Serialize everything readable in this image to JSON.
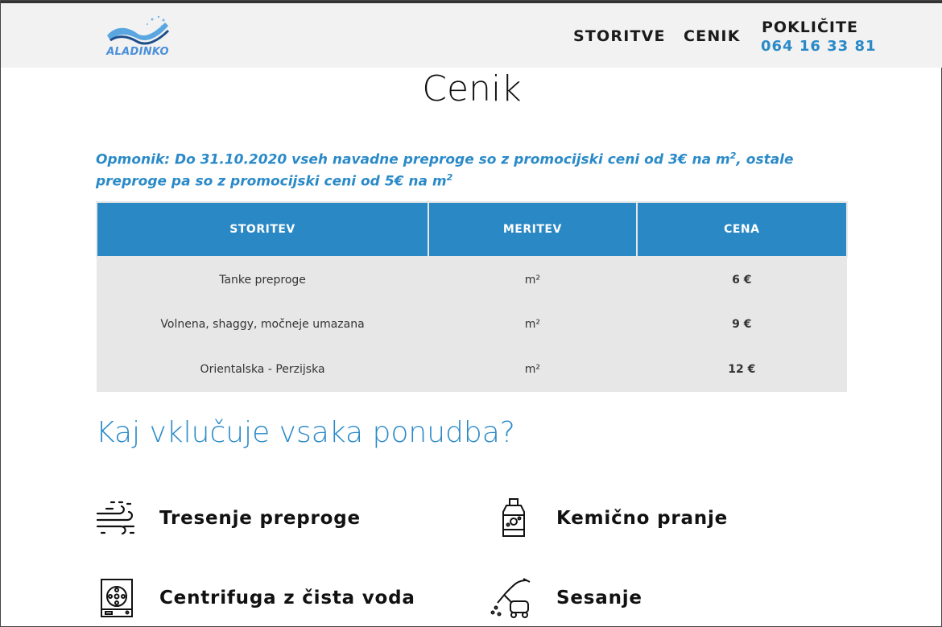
{
  "header": {
    "logo_text": "ALADINKO",
    "nav": [
      "STORITVE",
      "CENIK"
    ],
    "call_label": "POKLIČITE",
    "phone": "064 16 33 81"
  },
  "page": {
    "title": "Cenik",
    "note_main": "Opmonik: Do 31.10.2020 vseh navadne preproge so z promocijski ceni od 3€ na m",
    "note_after": ", ostale preproge pa so z promocijski ceni od 5€ na m",
    "note_sup": "2"
  },
  "table": {
    "headers": [
      "STORITEV",
      "MERITEV",
      "CENA"
    ],
    "rows": [
      [
        "Tanke preproge",
        "m²",
        "6 €"
      ],
      [
        "Volnena, shaggy, močneje umazana",
        "m²",
        "9 €"
      ],
      [
        "Orientalska - Perzijska",
        "m²",
        "12 €"
      ]
    ]
  },
  "includes": {
    "title": "Kaj vklučuje vsaka ponudba?",
    "items": [
      {
        "label": "Tresenje preproge",
        "icon": "wind-shake-icon"
      },
      {
        "label": "Kemično pranje",
        "icon": "detergent-bottle-icon"
      },
      {
        "label": "Centrifuga z čista voda",
        "icon": "washing-machine-icon"
      },
      {
        "label": "Sesanje",
        "icon": "vacuum-cleaner-icon"
      }
    ]
  },
  "colors": {
    "accent": "#2a8ac8",
    "header_bg": "#f2f2f2",
    "table_head": "#2a88c5",
    "table_row": "#e7e7e7"
  }
}
